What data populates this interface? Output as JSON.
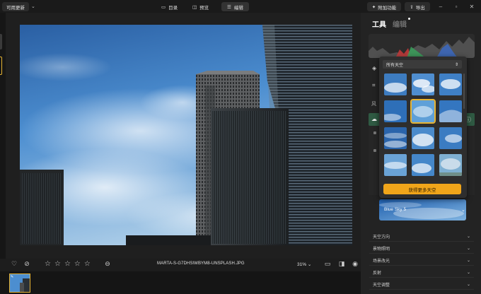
{
  "topbar": {
    "left_badge": "可用更新",
    "tabs": [
      {
        "label": "目录",
        "icon": "folder-icon"
      },
      {
        "label": "预览",
        "icon": "compare-icon"
      },
      {
        "label": "编辑",
        "icon": "sliders-icon"
      }
    ],
    "addons_label": "附加功能",
    "export_label": "导出"
  },
  "panel": {
    "tab_tools": "工具",
    "tab_edit": "编辑",
    "section_letter": "风"
  },
  "popover": {
    "dropdown_value": "所有天空",
    "get_more_label": "获得更多天空",
    "selected_sky": "Blue Sky 5"
  },
  "settings_rows": [
    {
      "label": "天空方向"
    },
    {
      "label": "景物照明"
    },
    {
      "label": "场景改光"
    },
    {
      "label": "反射"
    },
    {
      "label": "天空调整"
    }
  ],
  "bottombar": {
    "filename": "MARTA-S-G7DHSIWBYM8-UNSPLASH.JPG",
    "zoom": "31%",
    "stars": 5,
    "rating": 0
  },
  "colors": {
    "accent": "#e6b333",
    "panel_bg": "#232323",
    "sky_blue": "#3f7fc4"
  }
}
